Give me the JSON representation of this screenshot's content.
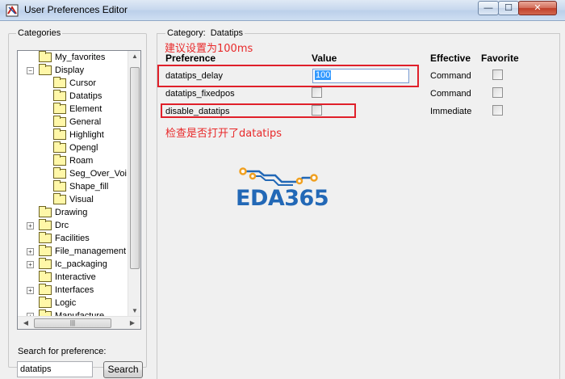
{
  "window": {
    "title": "User Preferences Editor",
    "min_glyph": "—",
    "max_glyph": "☐",
    "close_glyph": "✕"
  },
  "left": {
    "categories_label": "Categories",
    "tree": [
      {
        "label": "My_favorites",
        "level": 0,
        "expander": ""
      },
      {
        "label": "Display",
        "level": 0,
        "expander": "−"
      },
      {
        "label": "Cursor",
        "level": 1,
        "expander": ""
      },
      {
        "label": "Datatips",
        "level": 1,
        "expander": "",
        "selected": true
      },
      {
        "label": "Element",
        "level": 1,
        "expander": ""
      },
      {
        "label": "General",
        "level": 1,
        "expander": ""
      },
      {
        "label": "Highlight",
        "level": 1,
        "expander": ""
      },
      {
        "label": "Opengl",
        "level": 1,
        "expander": ""
      },
      {
        "label": "Roam",
        "level": 1,
        "expander": ""
      },
      {
        "label": "Seg_Over_Voi",
        "level": 1,
        "expander": ""
      },
      {
        "label": "Shape_fill",
        "level": 1,
        "expander": ""
      },
      {
        "label": "Visual",
        "level": 1,
        "expander": ""
      },
      {
        "label": "Drawing",
        "level": 0,
        "expander": ""
      },
      {
        "label": "Drc",
        "level": 0,
        "expander": "+"
      },
      {
        "label": "Facilities",
        "level": 0,
        "expander": ""
      },
      {
        "label": "File_management",
        "level": 0,
        "expander": "+"
      },
      {
        "label": "Ic_packaging",
        "level": 0,
        "expander": "+"
      },
      {
        "label": "Interactive",
        "level": 0,
        "expander": ""
      },
      {
        "label": "Interfaces",
        "level": 0,
        "expander": "+"
      },
      {
        "label": "Logic",
        "level": 0,
        "expander": ""
      },
      {
        "label": "Manufacture",
        "level": 0,
        "expander": "+"
      }
    ],
    "search_label": "Search for preference:",
    "search_value": "datatips",
    "search_button": "Search"
  },
  "right": {
    "category_prefix": "Category:",
    "category_value": "Datatips",
    "note1": "建议设置为100ms",
    "note2": "检查是否打开了datatips",
    "headers": {
      "preference": "Preference",
      "value": "Value",
      "effective": "Effective",
      "favorite": "Favorite"
    },
    "rows": [
      {
        "name": "datatips_delay",
        "value": "100",
        "effective": "Command"
      },
      {
        "name": "datatips_fixedpos",
        "value": "",
        "effective": "Command"
      },
      {
        "name": "disable_datatips",
        "value": "",
        "effective": "Immediate"
      }
    ],
    "logo_text": "EDA365"
  },
  "colors": {
    "annotation_red": "#e0202a",
    "logo_blue": "#2268b6",
    "logo_orange": "#f0a020"
  }
}
